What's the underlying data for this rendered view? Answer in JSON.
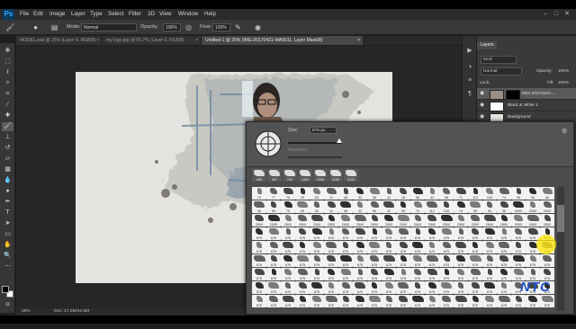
{
  "app": {
    "logo": "Ps"
  },
  "menu": [
    "File",
    "Edit",
    "Image",
    "Layer",
    "Type",
    "Select",
    "Filter",
    "3D",
    "View",
    "Window",
    "Help"
  ],
  "window_controls": [
    "–",
    "□",
    "✕"
  ],
  "options_bar": {
    "mode_label": "Mode:",
    "mode_value": "Normal",
    "opacity_label": "Opacity:",
    "opacity_value": "100%",
    "flow_label": "Flow:",
    "flow_value": "100%"
  },
  "tabs": [
    {
      "label": "MODEL.psd @ 25% (Layer 4, RGB/8)",
      "active": false
    },
    {
      "label": "my logo.jpg @ 66.7% (Layer 0, RGB/8)",
      "active": false
    },
    {
      "label": "Untitled-1 @ 25% (IMG-20170421-WA0011, Layer Mask/8)",
      "active": true
    }
  ],
  "status": {
    "zoom": "25%",
    "doc": "Doc: 17.2M/42.8M"
  },
  "brush_picker": {
    "size_label": "Size:",
    "size_value": "675 px",
    "hardness_label": "Hardness:",
    "preset_sizes": [
      "400",
      "367",
      "700",
      "1900",
      "1900",
      "4100",
      "3100"
    ],
    "row_labels": [
      [
        "70",
        "77",
        "76",
        "39",
        "63",
        "11",
        "48",
        "32",
        "55",
        "42",
        "18",
        "36",
        "42",
        "55",
        "71",
        "112",
        "134",
        "74",
        "95",
        "90",
        "36"
      ],
      [
        "46",
        "60",
        "75",
        "59",
        "63",
        "11",
        "48",
        "32",
        "55",
        "42",
        "55",
        "70",
        "112",
        "134",
        "74",
        "95",
        "90",
        "36",
        "2500",
        "2500",
        "2500"
      ],
      [
        "2500",
        "2500",
        "2500",
        "2500",
        "2500",
        "2500",
        "2500",
        "2500",
        "2500",
        "2500",
        "2500",
        "2500",
        "2500",
        "2500",
        "2500",
        "2500",
        "2500",
        "2500",
        "2500",
        "2500",
        "2500"
      ],
      [
        "675",
        "675",
        "675",
        "675",
        "675",
        "675",
        "675",
        "675",
        "675",
        "675",
        "675",
        "675",
        "675",
        "675",
        "675",
        "675",
        "675",
        "675",
        "675",
        "675",
        "675"
      ],
      [
        "675",
        "675",
        "675",
        "675",
        "675",
        "675",
        "675",
        "675",
        "675",
        "675",
        "675",
        "675",
        "675",
        "675",
        "675",
        "675",
        "675",
        "675",
        "675",
        "675",
        "675"
      ],
      [
        "675",
        "675",
        "675",
        "675",
        "675",
        "675",
        "675",
        "675",
        "675",
        "675",
        "675",
        "675",
        "675",
        "675",
        "675",
        "675",
        "675",
        "675",
        "675",
        "675",
        "675"
      ],
      [
        "675",
        "675",
        "675",
        "675",
        "675",
        "675",
        "675",
        "675",
        "675",
        "675",
        "675",
        "675",
        "675",
        "675",
        "675",
        "675",
        "675",
        "675",
        "675",
        "675",
        "675"
      ],
      [
        "675",
        "675",
        "675",
        "675",
        "675",
        "675",
        "675",
        "675",
        "675",
        "675",
        "675",
        "675",
        "675",
        "675",
        "675",
        "675",
        "675",
        "675",
        "675",
        "675",
        "675"
      ],
      [
        "675",
        "675",
        "675",
        "675",
        "675",
        "675",
        "675",
        "675",
        "675",
        "675",
        "675",
        "675",
        "675",
        "675",
        "675",
        "675",
        "675",
        "675",
        "675",
        "675",
        "675"
      ]
    ]
  },
  "layers_panel": {
    "tab": "Layers",
    "kind": "Kind",
    "blend": "Normal",
    "opacity_label": "Opacity:",
    "opacity_value": "100%",
    "lock_label": "Lock:",
    "fill_label": "Fill:",
    "fill_value": "100%",
    "layers": [
      {
        "name": "IMG-20170421-...",
        "selected": true,
        "thumb": "#9a8f86"
      },
      {
        "name": "Black & White 1",
        "selected": false,
        "thumb": "#ffffff"
      },
      {
        "name": "Background",
        "selected": false,
        "thumb": "#e4e3df"
      }
    ]
  },
  "watermark": "NTC",
  "colors": {
    "accent": "#31a8ff",
    "highlight": "#ffe600",
    "watermark": "#1d52c9"
  }
}
